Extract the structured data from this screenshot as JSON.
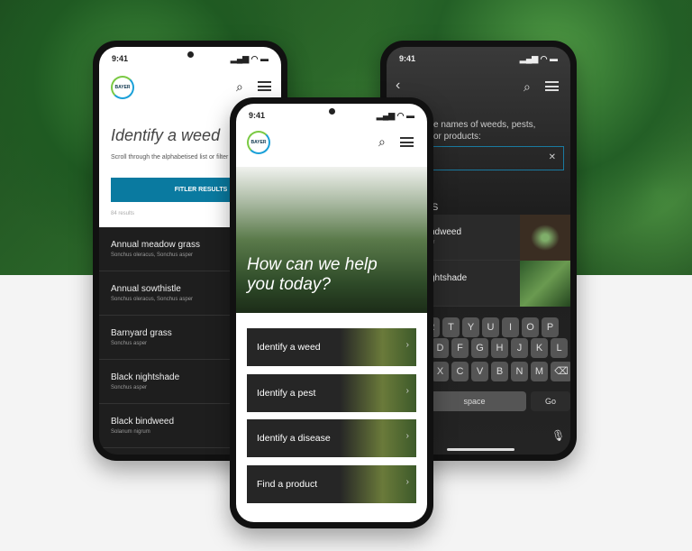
{
  "status_time": "9:41",
  "logo_text": "BAYER",
  "left": {
    "title": "Identify a weed",
    "subtitle": "Scroll through the alphabetised list or filter by type",
    "filter_button": "FITLER RESULTS",
    "results_count": "84 results",
    "items": [
      {
        "name": "Annual meadow grass",
        "latin": "Sonchus oleracus, Sonchus asper"
      },
      {
        "name": "Annual sowthistle",
        "latin": "Sonchus oleracus, Sonchus asper"
      },
      {
        "name": "Barnyard grass",
        "latin": "Sonchus asper"
      },
      {
        "name": "Black nightshade",
        "latin": "Sonchus asper"
      },
      {
        "name": "Black bindweed",
        "latin": "Solanum nigrum"
      }
    ]
  },
  "center": {
    "hero": "How can we help you today?",
    "cards": [
      "Identify a weed",
      "Identify a pest",
      "Identify a disease",
      "Find a product"
    ]
  },
  "right": {
    "prompt": "e names of weeds, pests, or products:",
    "section_fragment": "S",
    "results": [
      {
        "name": "ndweed",
        "latin": "er"
      },
      {
        "name": "ghtshade",
        "latin": ""
      }
    ],
    "keys_row1": [
      "R",
      "T",
      "Y",
      "U",
      "I",
      "O",
      "P"
    ],
    "keys_row2": [
      "D",
      "F",
      "G",
      "H",
      "J",
      "K",
      "L"
    ],
    "keys_row3": [
      "X",
      "C",
      "V",
      "B",
      "N",
      "M"
    ],
    "space_label": "space",
    "go_label": "Go"
  },
  "colors": {
    "accent": "#0a7aa0",
    "dark": "#222222"
  }
}
